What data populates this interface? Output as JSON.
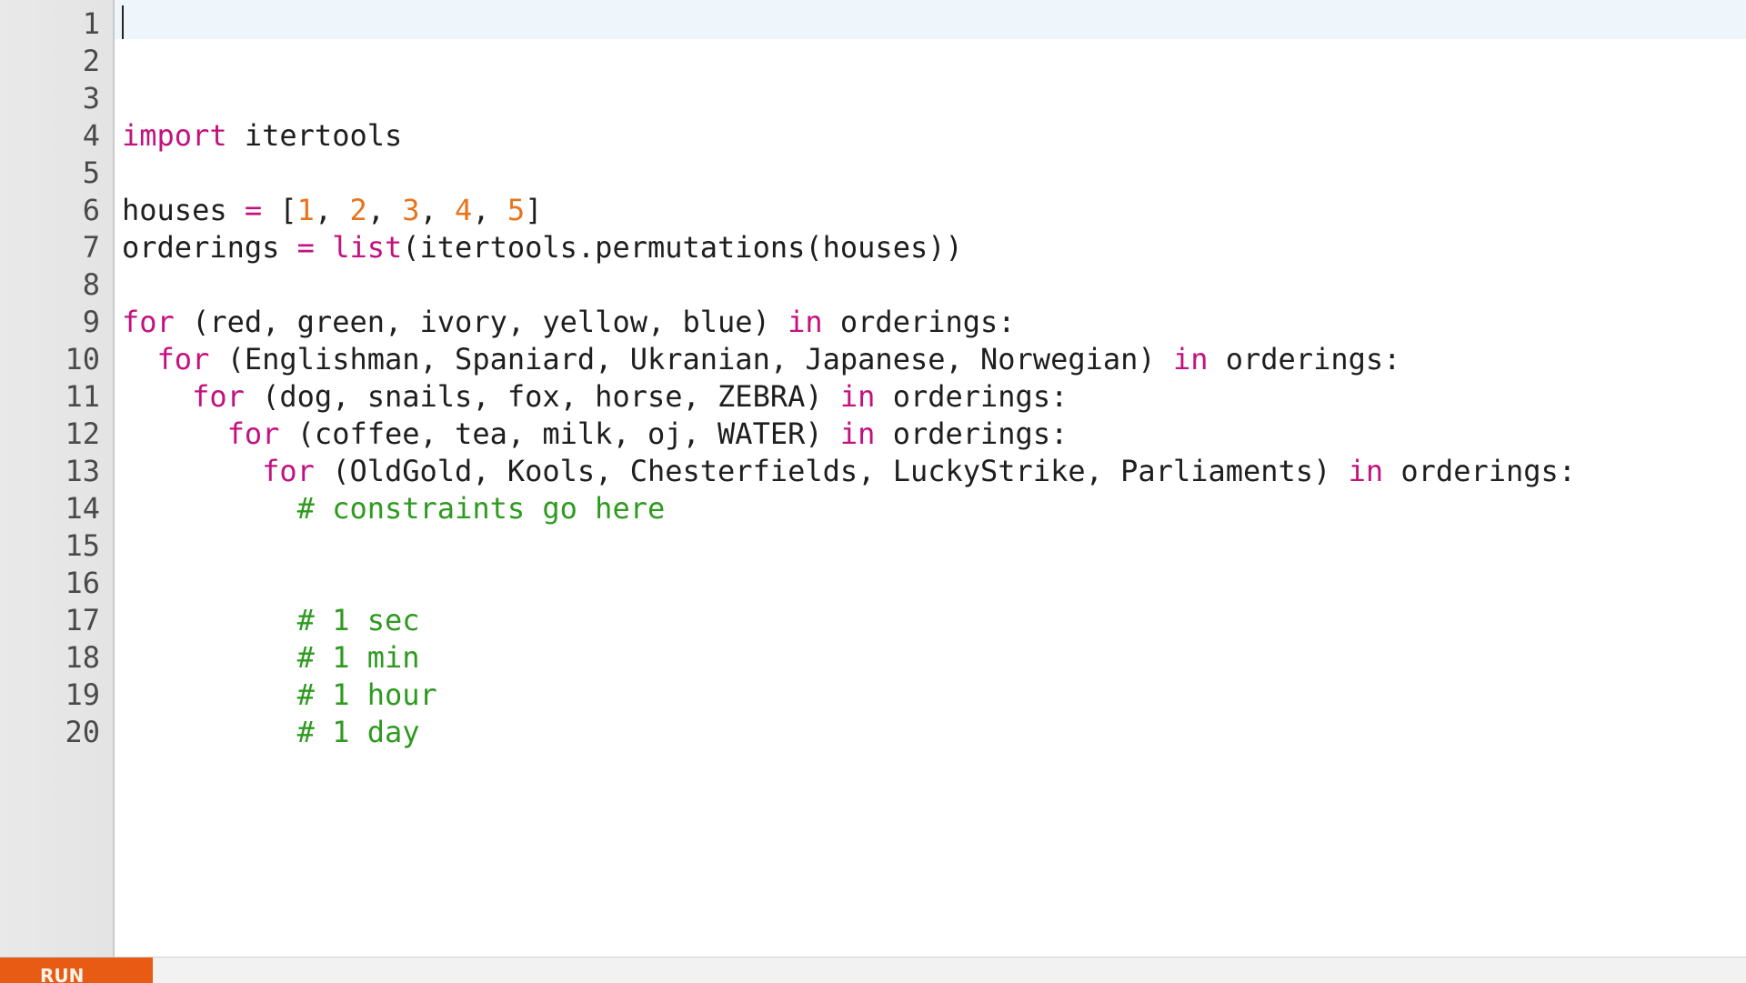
{
  "editor": {
    "line_numbers": [
      "1",
      "2",
      "3",
      "4",
      "5",
      "6",
      "7",
      "8",
      "9",
      "10",
      "11",
      "12",
      "13",
      "14",
      "15",
      "16",
      "17",
      "18",
      "19",
      "20"
    ],
    "lines": {
      "l1": [],
      "l2": [],
      "l3": [],
      "l4": [
        {
          "t": "import",
          "c": "kw"
        },
        {
          "t": " itertools",
          "c": ""
        }
      ],
      "l5": [],
      "l6": [
        {
          "t": "houses ",
          "c": ""
        },
        {
          "t": "=",
          "c": "op"
        },
        {
          "t": " [",
          "c": ""
        },
        {
          "t": "1",
          "c": "num"
        },
        {
          "t": ", ",
          "c": ""
        },
        {
          "t": "2",
          "c": "num"
        },
        {
          "t": ", ",
          "c": ""
        },
        {
          "t": "3",
          "c": "num"
        },
        {
          "t": ", ",
          "c": ""
        },
        {
          "t": "4",
          "c": "num"
        },
        {
          "t": ", ",
          "c": ""
        },
        {
          "t": "5",
          "c": "num"
        },
        {
          "t": "]",
          "c": ""
        }
      ],
      "l7": [
        {
          "t": "orderings ",
          "c": ""
        },
        {
          "t": "=",
          "c": "op"
        },
        {
          "t": " ",
          "c": ""
        },
        {
          "t": "list",
          "c": "kw"
        },
        {
          "t": "(itertools.permutations(houses))",
          "c": ""
        }
      ],
      "l8": [],
      "l9": [
        {
          "t": "for",
          "c": "kw"
        },
        {
          "t": " (red, green, ivory, yellow, blue) ",
          "c": ""
        },
        {
          "t": "in",
          "c": "kw"
        },
        {
          "t": " orderings:",
          "c": ""
        }
      ],
      "l10": [
        {
          "t": "  ",
          "c": ""
        },
        {
          "t": "for",
          "c": "kw"
        },
        {
          "t": " (Englishman, Spaniard, Ukranian, Japanese, Norwegian) ",
          "c": ""
        },
        {
          "t": "in",
          "c": "kw"
        },
        {
          "t": " orderings:",
          "c": ""
        }
      ],
      "l11": [
        {
          "t": "    ",
          "c": ""
        },
        {
          "t": "for",
          "c": "kw"
        },
        {
          "t": " (dog, snails, fox, horse, ZEBRA) ",
          "c": ""
        },
        {
          "t": "in",
          "c": "kw"
        },
        {
          "t": " orderings:",
          "c": ""
        }
      ],
      "l12": [
        {
          "t": "      ",
          "c": ""
        },
        {
          "t": "for",
          "c": "kw"
        },
        {
          "t": " (coffee, tea, milk, oj, WATER) ",
          "c": ""
        },
        {
          "t": "in",
          "c": "kw"
        },
        {
          "t": " orderings:",
          "c": ""
        }
      ],
      "l13": [
        {
          "t": "        ",
          "c": ""
        },
        {
          "t": "for",
          "c": "kw"
        },
        {
          "t": " (OldGold, Kools, Chesterfields, LuckyStrike, Parliaments) ",
          "c": ""
        },
        {
          "t": "in",
          "c": "kw"
        },
        {
          "t": " orderings:",
          "c": ""
        }
      ],
      "l14": [
        {
          "t": "          ",
          "c": ""
        },
        {
          "t": "# constraints go here",
          "c": "cm"
        }
      ],
      "l15": [],
      "l16": [],
      "l17": [
        {
          "t": "          ",
          "c": ""
        },
        {
          "t": "# 1 sec",
          "c": "cm"
        }
      ],
      "l18": [
        {
          "t": "          ",
          "c": ""
        },
        {
          "t": "# 1 min",
          "c": "cm"
        }
      ],
      "l19": [
        {
          "t": "          ",
          "c": ""
        },
        {
          "t": "# 1 hour",
          "c": "cm"
        }
      ],
      "l20": [
        {
          "t": "          ",
          "c": ""
        },
        {
          "t": "# 1 day",
          "c": "cm"
        }
      ]
    }
  },
  "toolbar": {
    "run_label": "RUN"
  },
  "colors": {
    "keyword": "#c3127e",
    "number": "#e8731b",
    "comment": "#2e9a1f",
    "run_button": "#e85b14"
  }
}
